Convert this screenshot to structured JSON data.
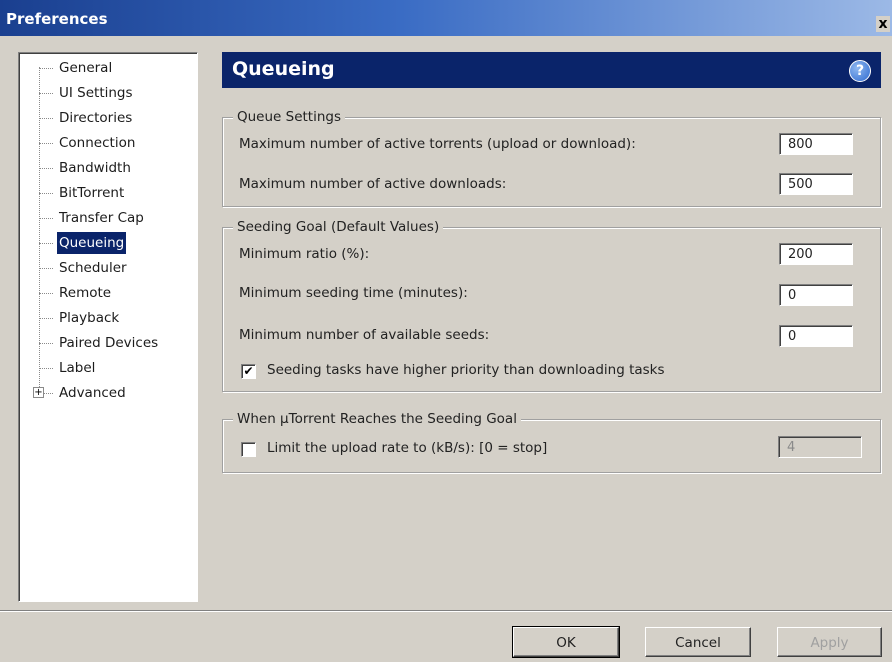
{
  "window": {
    "title": "Preferences",
    "close_glyph": "x"
  },
  "tree": {
    "items": [
      {
        "label": "General"
      },
      {
        "label": "UI Settings"
      },
      {
        "label": "Directories"
      },
      {
        "label": "Connection"
      },
      {
        "label": "Bandwidth"
      },
      {
        "label": "BitTorrent"
      },
      {
        "label": "Transfer Cap"
      },
      {
        "label": "Queueing",
        "selected": true
      },
      {
        "label": "Scheduler"
      },
      {
        "label": "Remote"
      },
      {
        "label": "Playback"
      },
      {
        "label": "Paired Devices"
      },
      {
        "label": "Label"
      },
      {
        "label": "Advanced",
        "expandable": true
      }
    ],
    "expander_glyph": "+"
  },
  "header": {
    "title": "Queueing",
    "help_glyph": "?"
  },
  "queue_settings": {
    "legend": "Queue Settings",
    "max_active_torrents_label": "Maximum number of active torrents (upload or download):",
    "max_active_torrents_value": "800",
    "max_active_downloads_label": "Maximum number of active downloads:",
    "max_active_downloads_value": "500"
  },
  "seeding_goal": {
    "legend": "Seeding Goal (Default Values)",
    "min_ratio_label": "Minimum ratio (%):",
    "min_ratio_value": "200",
    "min_seeding_time_label": "Minimum seeding time (minutes):",
    "min_seeding_time_value": "0",
    "min_available_seeds_label": "Minimum number of available seeds:",
    "min_available_seeds_value": "0",
    "priority_checkbox_label": "Seeding tasks have higher priority than downloading tasks",
    "priority_checked": true,
    "check_glyph": "✔"
  },
  "reaches_goal": {
    "legend": "When µTorrent Reaches the Seeding Goal",
    "limit_checkbox_label": "Limit the upload rate to (kB/s): [0 = stop]",
    "limit_checked": false,
    "limit_value": "4"
  },
  "buttons": {
    "ok": "OK",
    "cancel": "Cancel",
    "apply": "Apply"
  }
}
